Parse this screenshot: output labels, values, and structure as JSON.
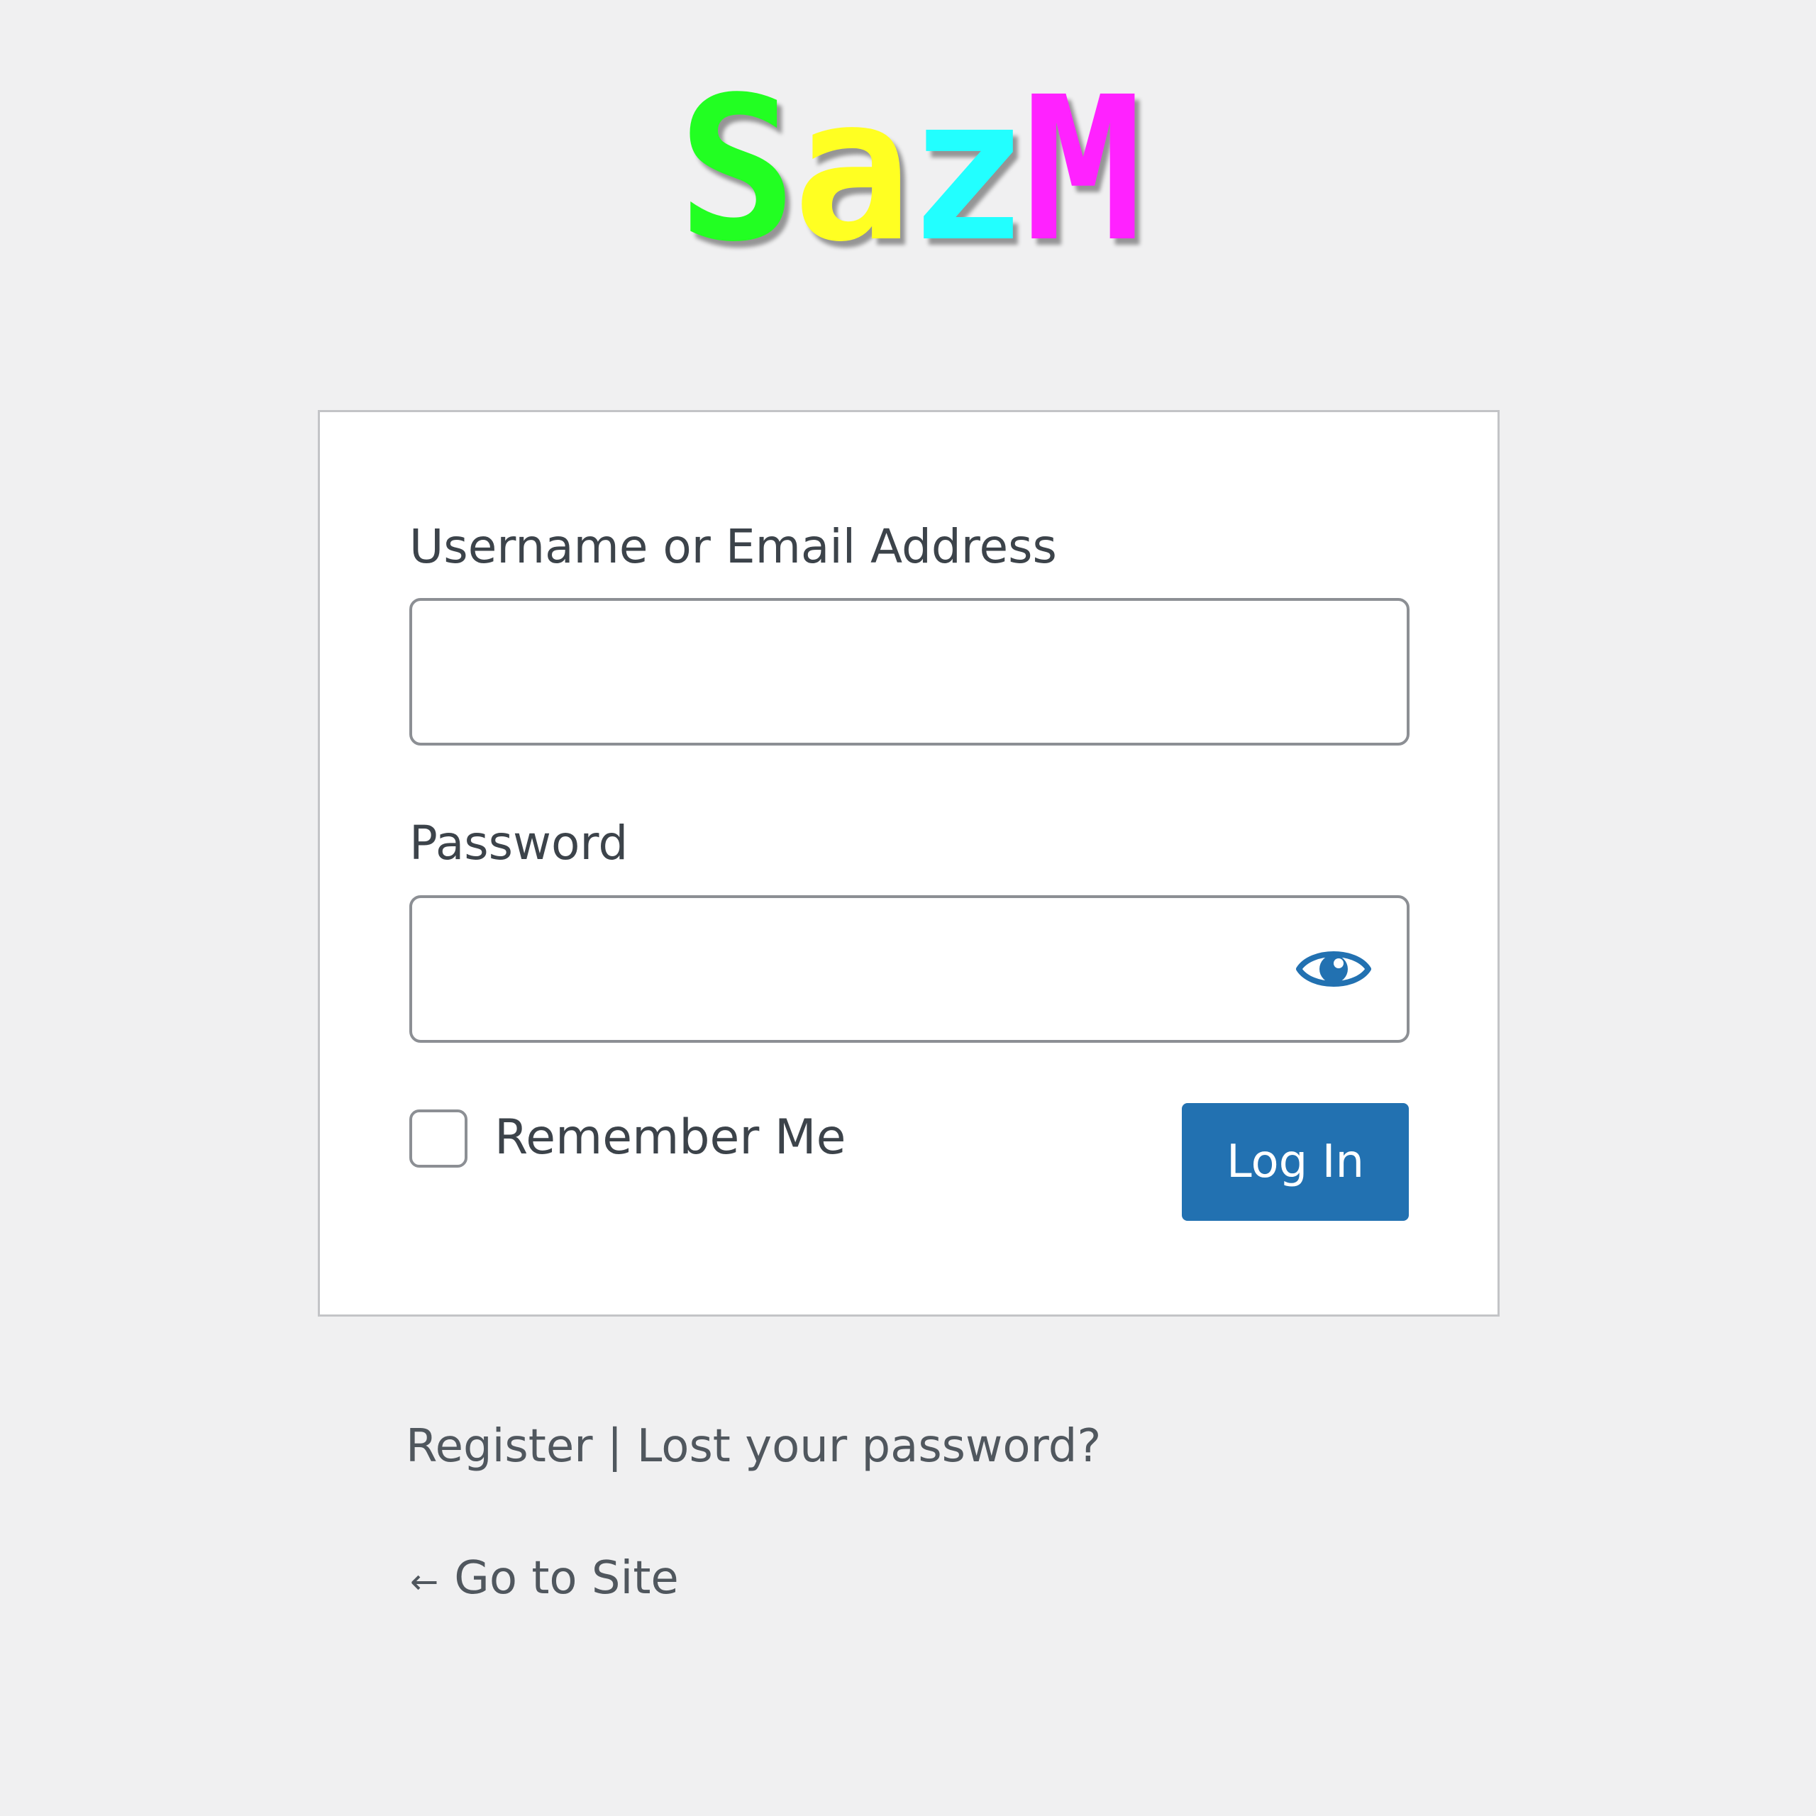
{
  "logo": {
    "letters": [
      {
        "char": "S",
        "color": "#22ff22"
      },
      {
        "char": "a",
        "color": "#ffff22"
      },
      {
        "char": "z",
        "color": "#22ffff"
      },
      {
        "char": "M",
        "color": "#ff22ff"
      }
    ]
  },
  "form": {
    "username_label": "Username or Email Address",
    "username_value": "",
    "password_label": "Password",
    "password_value": "",
    "show_password_icon": "eye-icon",
    "remember_label": "Remember Me",
    "remember_checked": false,
    "login_label": "Log In"
  },
  "links": {
    "register": "Register",
    "separator": "|",
    "lost_password": "Lost your password?",
    "go_to_site_arrow": "←",
    "go_to_site": "Go to Site"
  },
  "colors": {
    "background": "#f0f0f1",
    "primary_button": "#2271b1"
  }
}
